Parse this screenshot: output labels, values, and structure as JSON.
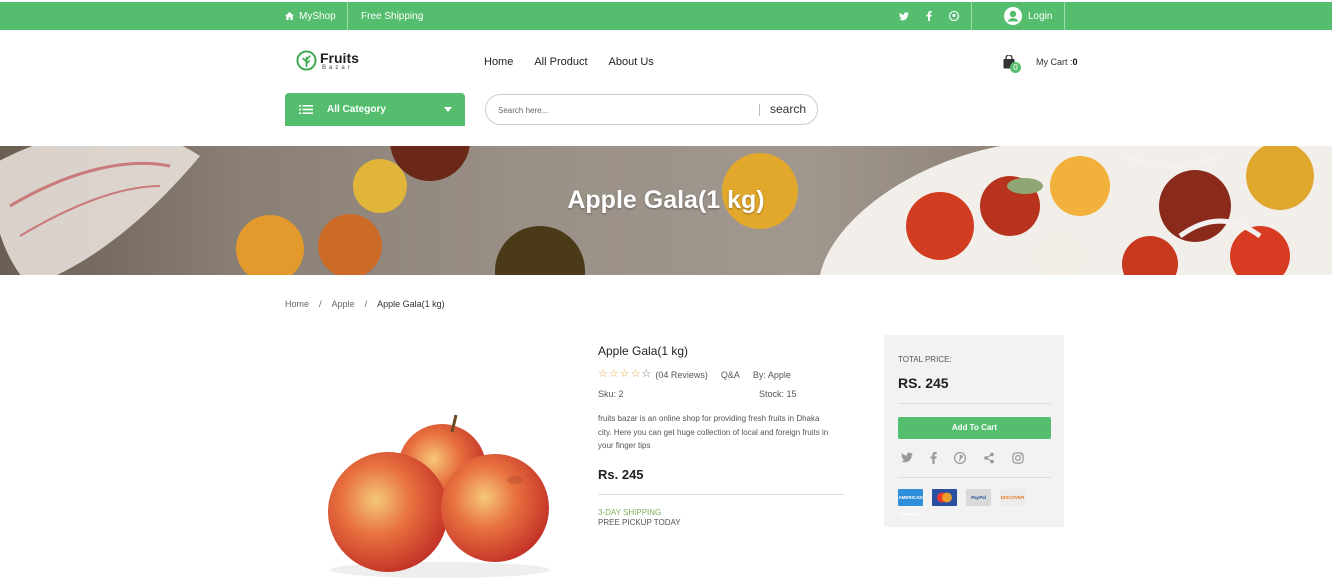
{
  "topbar": {
    "shop_name": "MyShop",
    "shipping": "Free Shipping",
    "social_icons": [
      "twitter-icon",
      "facebook-icon",
      "pinterest-icon"
    ],
    "login": "Login"
  },
  "logo": {
    "line1": "Fruits",
    "line2": "Bazar"
  },
  "nav": {
    "home": "Home",
    "all_product": "All Product",
    "about": "About Us"
  },
  "cart": {
    "count": "0",
    "label": "My Cart :",
    "total": "0"
  },
  "category": {
    "label": "All Category"
  },
  "search": {
    "placeholder": "Search here...",
    "button": "search"
  },
  "banner": {
    "title": "Apple Gala(1 kg)"
  },
  "breadcrumb": {
    "home": "Home",
    "sep": "/",
    "category": "Apple",
    "current": "Apple Gala(1 kg)"
  },
  "product": {
    "name": "Apple Gala(1 kg)",
    "rating": 0,
    "max_rating": 5,
    "reviews": "(04 Reviews)",
    "qa": "Q&A",
    "by": "By: Apple",
    "sku": "Sku: 2",
    "stock": "Stock: 15",
    "description": "fruits bazar is an online shop for providing fresh fruits in Dhaka city. Here you can get huge collection of local and foreign fruits in your finger tips",
    "price": "Rs. 245",
    "shipping_line1": "3-DAY SHIPPING",
    "shipping_line2": "PREE PICKUP TODAY"
  },
  "panel": {
    "total_label": "TOTAL PRICE:",
    "total_value": "RS. 245",
    "add_to_cart": "Add To Cart",
    "share_icons": [
      "twitter-icon",
      "facebook-icon",
      "pinterest-icon",
      "share-icon",
      "instagram-icon"
    ],
    "cards": [
      "AMERICAN EXPRESS",
      "mastercard",
      "PayPal",
      "DISCOVER"
    ]
  },
  "colors": {
    "brand": "#55be6e",
    "star": "#e8a23a",
    "shipping": "#7ab35b"
  }
}
